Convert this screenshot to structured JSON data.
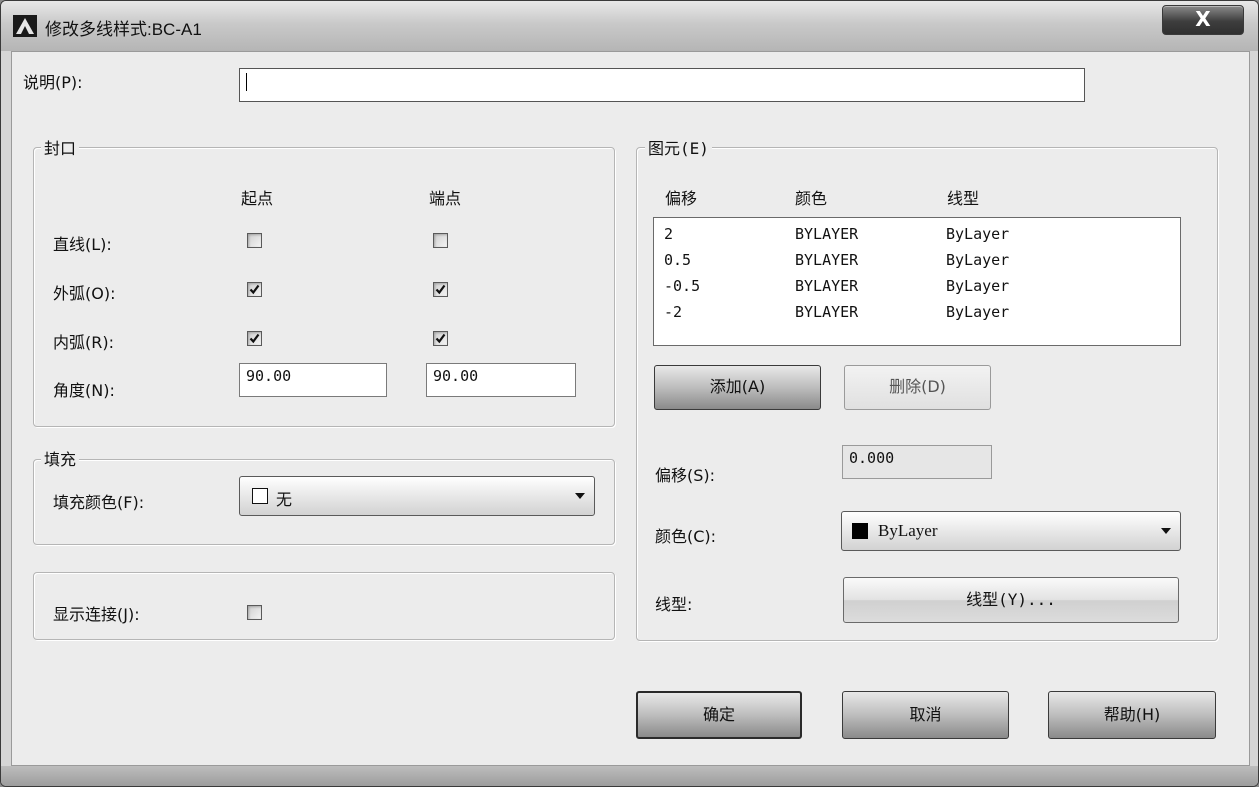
{
  "window": {
    "title": "修改多线样式:BC-A1",
    "close_label": "X"
  },
  "description": {
    "label": "说明(P):",
    "value": ""
  },
  "caps": {
    "group_title": "封口",
    "col_start": "起点",
    "col_end": "端点",
    "line_label": "直线(L):",
    "outer_arc_label": "外弧(O):",
    "inner_arc_label": "内弧(R):",
    "angle_label": "角度(N):",
    "line_start": false,
    "line_end": false,
    "outer_arc_start": true,
    "outer_arc_end": true,
    "inner_arc_start": true,
    "inner_arc_end": true,
    "angle_start": "90.00",
    "angle_end": "90.00"
  },
  "fill": {
    "group_title": "填充",
    "label": "填充颜色(F):",
    "value": "无",
    "swatch_color": "#ffffff"
  },
  "joints": {
    "label": "显示连接(J):",
    "checked": false
  },
  "elements": {
    "group_title": "图元(E)",
    "headers": [
      "偏移",
      "颜色",
      "线型"
    ],
    "rows": [
      {
        "offset": "2",
        "color": "BYLAYER",
        "linetype": "ByLayer"
      },
      {
        "offset": "0.5",
        "color": "BYLAYER",
        "linetype": "ByLayer"
      },
      {
        "offset": "-0.5",
        "color": "BYLAYER",
        "linetype": "ByLayer"
      },
      {
        "offset": "-2",
        "color": "BYLAYER",
        "linetype": "ByLayer"
      }
    ],
    "add_label": "添加(A)",
    "delete_label": "删除(D)",
    "offset_label": "偏移(S):",
    "offset_value": "0.000",
    "color_label": "颜色(C):",
    "color_value": "ByLayer",
    "color_swatch": "#000000",
    "linetype_label": "线型:",
    "linetype_button": "线型(Y)..."
  },
  "footer": {
    "ok_label": "确定",
    "cancel_label": "取消",
    "help_label": "帮助(H)"
  }
}
